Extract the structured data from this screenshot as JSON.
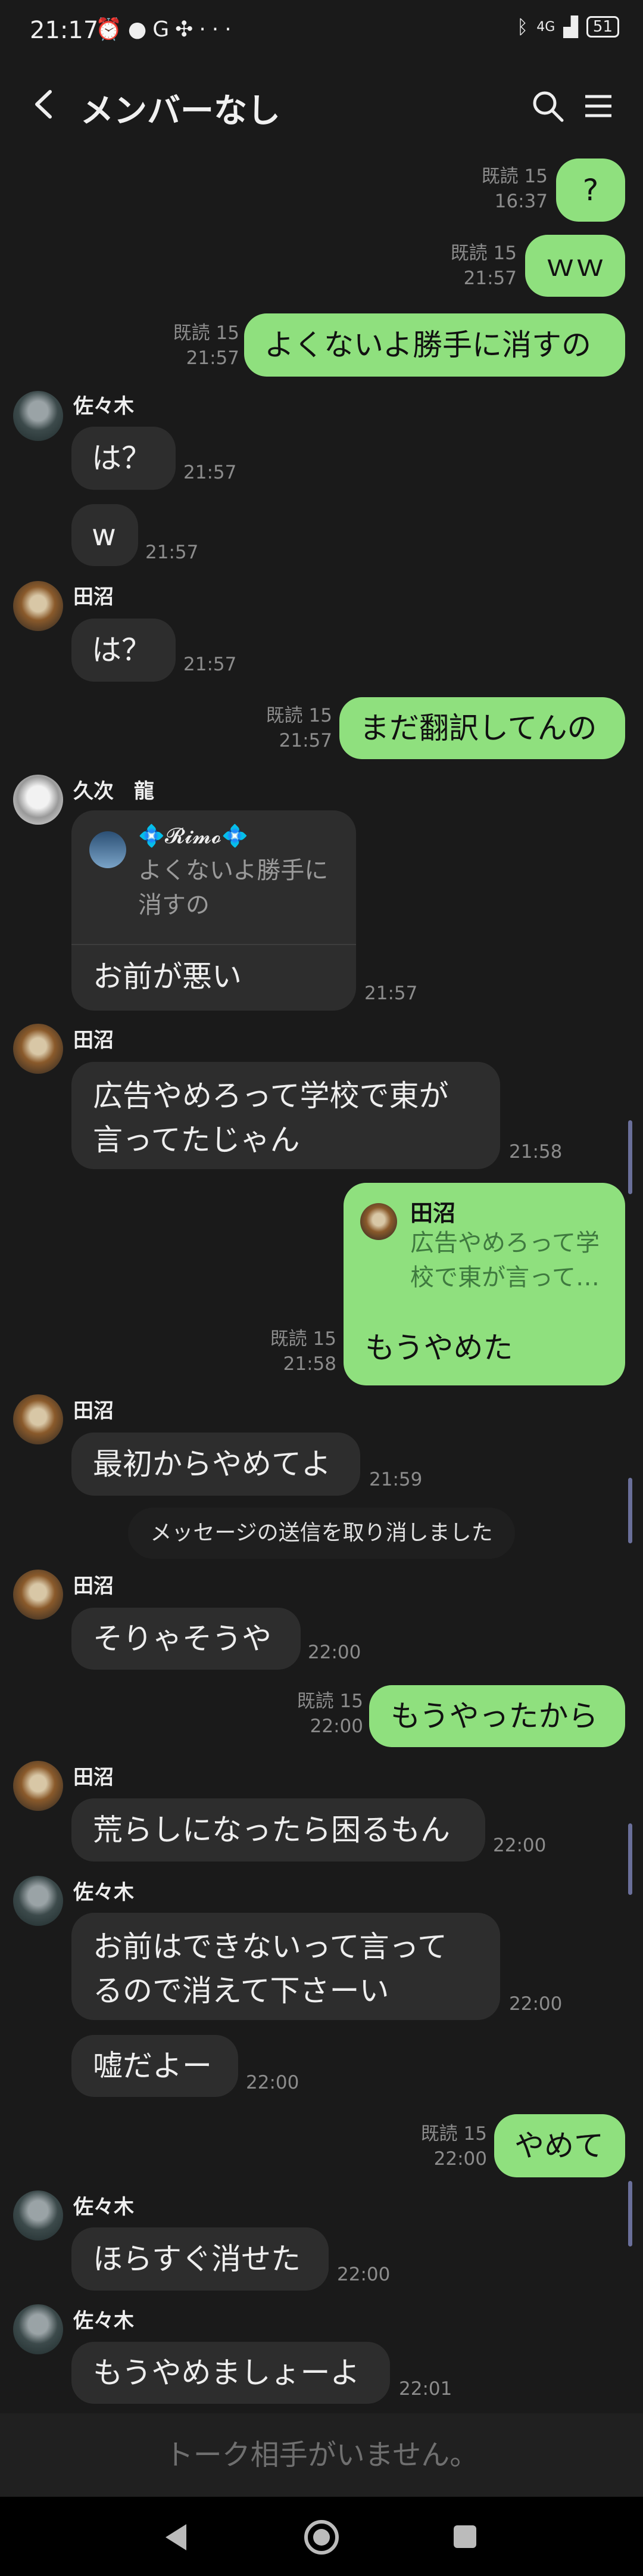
{
  "status": {
    "time": "21:17",
    "network": "4G",
    "battery": "51",
    "more": "···"
  },
  "header": {
    "title": "メンバーなし"
  },
  "messages": {
    "m1": {
      "text": "?",
      "read": "既読 15",
      "time": "16:37"
    },
    "m2": {
      "text": "ｗｗ",
      "read": "既読 15",
      "time": "21:57"
    },
    "m3": {
      "text": "よくないよ勝手に消すの",
      "read": "既読 15",
      "time": "21:57"
    },
    "m4": {
      "name": "佐々木",
      "text": "は？",
      "time": "21:57"
    },
    "m5": {
      "text": "w",
      "time": "21:57"
    },
    "m6": {
      "name": "田沼",
      "text": "は？",
      "time": "21:57"
    },
    "m7": {
      "text": "まだ翻訳してんの",
      "read": "既読 15",
      "time": "21:57"
    },
    "m8": {
      "name": "久次　龍",
      "quote_name": "💠𝓡𝓲𝓶𝓸💠",
      "quote_line1": "よくないよ勝手に",
      "quote_line2": "消すの",
      "text": "お前が悪い",
      "time": "21:57"
    },
    "m9": {
      "name": "田沼",
      "line1": "広告やめろって学校で東が",
      "line2": "言ってたじゃん",
      "time": "21:58"
    },
    "m10": {
      "quote_name": "田沼",
      "quote_line1": "広告やめろって学",
      "quote_line2": "校で東が言って…",
      "text": "もうやめた",
      "read": "既読 15",
      "time": "21:58"
    },
    "m11": {
      "name": "田沼",
      "text": "最初からやめてよ",
      "time": "21:59"
    },
    "system": "メッセージの送信を取り消しました",
    "m12": {
      "name": "田沼",
      "text": "そりゃそうや",
      "time": "22:00"
    },
    "m13": {
      "text": "もうやったから",
      "read": "既読 15",
      "time": "22:00"
    },
    "m14": {
      "name": "田沼",
      "text": "荒らしになったら困るもん",
      "time": "22:00"
    },
    "m15": {
      "name": "佐々木",
      "line1": "お前はできないって言って",
      "line2": "るので消えて下さーい",
      "time": "22:00"
    },
    "m16": {
      "text": "嘘だよー",
      "time": "22:00"
    },
    "m17": {
      "text": "やめて",
      "read": "既読 15",
      "time": "22:00"
    },
    "m18": {
      "name": "佐々木",
      "text": "ほらすぐ消せた",
      "time": "22:00"
    },
    "m19": {
      "name": "佐々木",
      "text": "もうやめましょーよ",
      "time": "22:01"
    }
  },
  "footer": {
    "text": "トーク相手がいません。"
  },
  "colors": {
    "outgoing": "#8fe07e",
    "incoming": "#2d2d2d",
    "background": "#1a1a1a"
  }
}
